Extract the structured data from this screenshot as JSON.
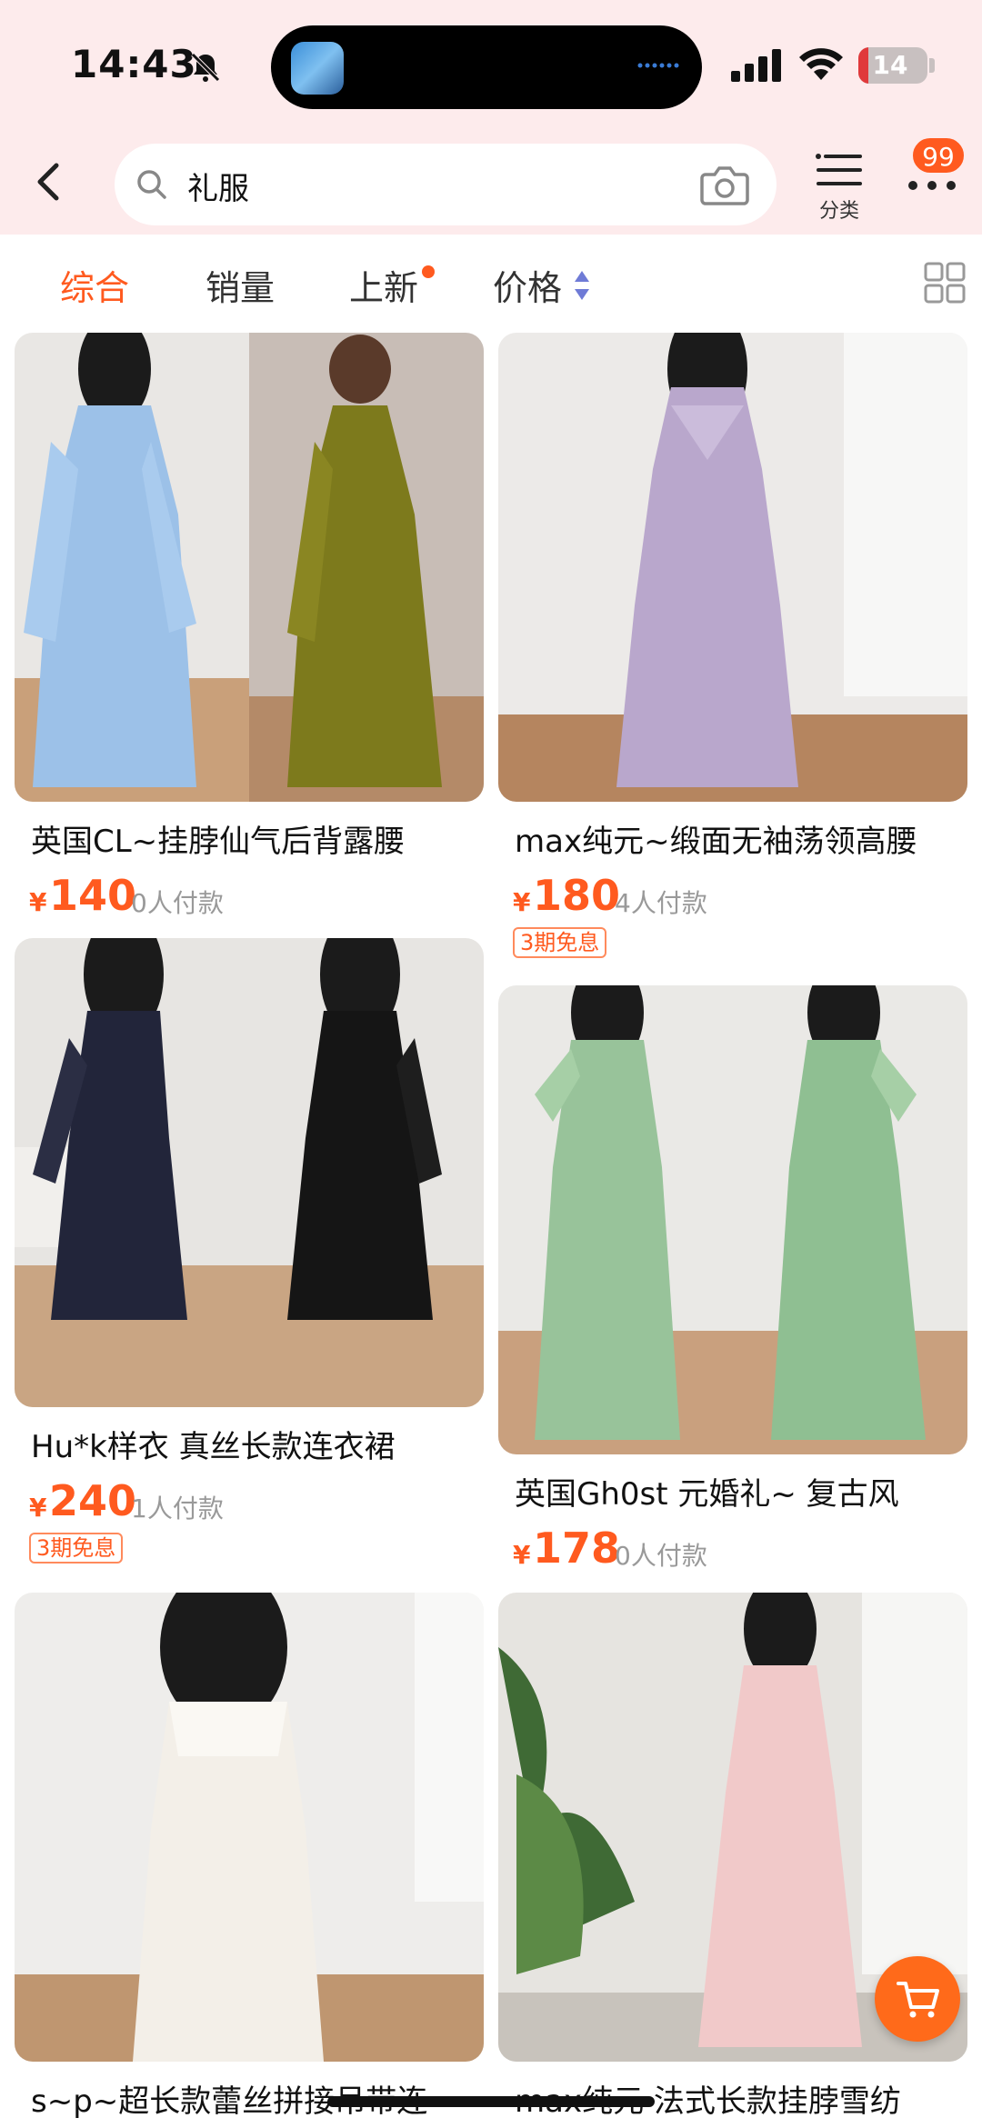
{
  "status_bar": {
    "time": "14:43",
    "battery": "14",
    "battery_level": 0.14
  },
  "header": {
    "search_query": "礼服",
    "category_label": "分类",
    "message_badge": "99"
  },
  "filters": [
    {
      "label": "综合",
      "active": true
    },
    {
      "label": "销量",
      "active": false
    },
    {
      "label": "上新",
      "active": false
    },
    {
      "label": "价格",
      "active": false
    }
  ],
  "products": [
    {
      "title": "英国CL~挂脖仙气后背露腰",
      "currency": "¥",
      "price": "140",
      "sold": "0人付款",
      "promo": ""
    },
    {
      "title": "max纯元~缎面无袖荡领高腰",
      "currency": "¥",
      "price": "180",
      "sold": "4人付款",
      "promo": "3期免息"
    },
    {
      "title": "Hu*k样衣  真丝长款连衣裙",
      "currency": "¥",
      "price": "240",
      "sold": "1人付款",
      "promo": "3期免息"
    },
    {
      "title": "英国Gh0st 元婚礼~ 复古风",
      "currency": "¥",
      "price": "178",
      "sold": "0人付款",
      "promo": ""
    },
    {
      "title": "s~p~超长款蕾丝拼接吊带连",
      "currency": "¥",
      "price": "",
      "sold": "",
      "promo": ""
    },
    {
      "title": "max纯元 法式长款挂脖雪纺",
      "currency": "¥",
      "price": "",
      "sold": "",
      "promo": ""
    }
  ],
  "colors": {
    "accent": "#ff5a1f",
    "header_bg": "#fdebec"
  }
}
